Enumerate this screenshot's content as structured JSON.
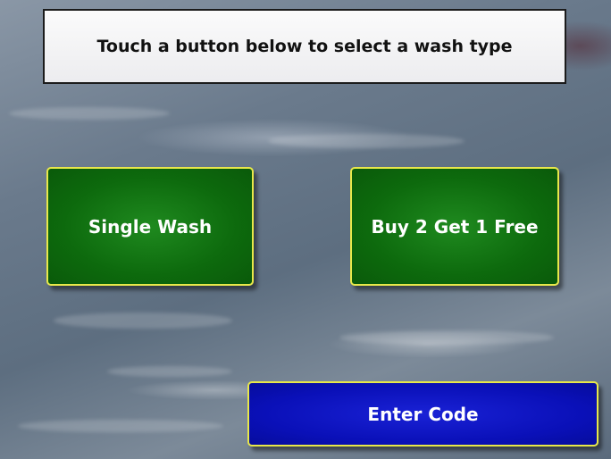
{
  "banner": {
    "text": "Touch a button below to select a wash type"
  },
  "buttons": {
    "single_wash": "Single Wash",
    "buy_two_get_one": "Buy 2 Get 1 Free",
    "enter_code": "Enter Code"
  },
  "colors": {
    "green_button": "#0d6a0d",
    "blue_button": "#0a10b8",
    "button_border": "#e8e84a",
    "banner_bg": "#f5f5f7"
  }
}
